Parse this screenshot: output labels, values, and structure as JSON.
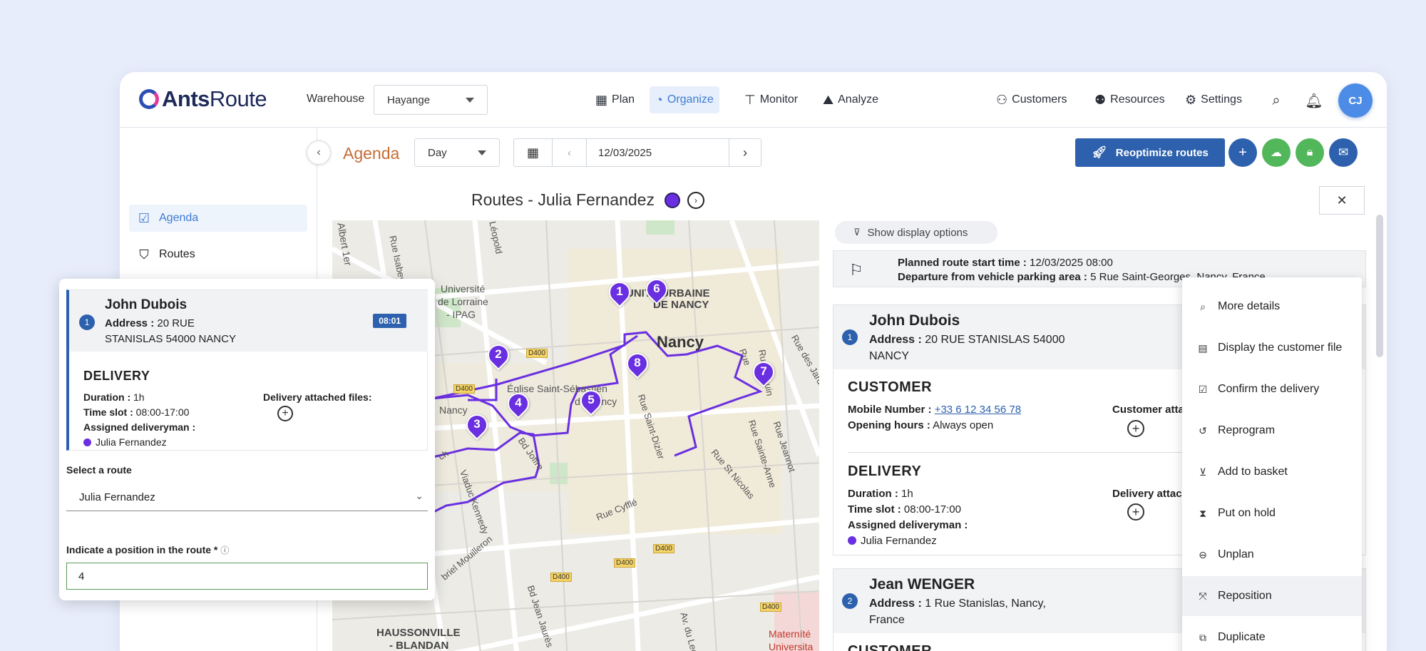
{
  "brand": {
    "name_bold": "Ants",
    "name_rest": "Route"
  },
  "header": {
    "warehouse_label": "Warehouse",
    "warehouse_value": "Hayange",
    "nav": {
      "plan": "Plan",
      "organize": "Organize",
      "monitor": "Monitor",
      "analyze": "Analyze"
    },
    "right": {
      "customers": "Customers",
      "resources": "Resources",
      "settings": "Settings"
    },
    "avatar": "CJ"
  },
  "sidebar": {
    "items": [
      {
        "label": "Agenda",
        "active": true
      },
      {
        "label": "Routes",
        "active": false
      }
    ]
  },
  "toolbar": {
    "title": "Agenda",
    "view": "Day",
    "date": "12/03/2025",
    "reoptimize": "Reoptimize routes"
  },
  "routes": {
    "title": "Routes - Julia Fernandez",
    "route_color": "#6a2fe0"
  },
  "map": {
    "labels": {
      "nancy": "Nancy",
      "urbaine": "UNITÉ URBAINE",
      "de_nancy": "DE NANCY",
      "univ1": "Université",
      "univ2": "de Lorraine",
      "univ3": "- IPAG",
      "eglise1": "Église Saint-Sébastien",
      "eglise2": "de Nancy",
      "nancy_small": "Nancy",
      "haussonville1": "HAUSSONVILLE",
      "haussonville2": "- BLANDAN",
      "maternite1": "Materníté",
      "maternite2": "Universita",
      "rue_st_dizier": "Rue Saint-Dizier",
      "rue_st_nicolas": "Rue St Nicolas",
      "rue_ste_anne": "Rue Sainte-Anne",
      "rue_jeannot": "Rue Jeannot",
      "rue_drouin": "Rue Drouin",
      "rue_jardins": "Rue des Jardins",
      "rue_cyffle": "Rue Cyfflé",
      "bd_joffre": "Bd Joffre",
      "viaduc": "Viaduc Kennedy",
      "mouilleron": "briel Mouilleron",
      "bd_jean": "Bd Jean Jaurès",
      "leclerc": "Av. du Leclerc",
      "leopold": "Léopold",
      "albert": "Albert 1er",
      "isabey": "Rue Isabey",
      "rue_st_georges": "Rue Saint-Georges",
      "rue_amp": "Rue",
      "bd_ch": "ch",
      "d400": "D400"
    },
    "pins": [
      "1",
      "2",
      "3",
      "4",
      "5",
      "6",
      "7",
      "8"
    ]
  },
  "details": {
    "display_options": "Show display options",
    "start_time_label": "Planned route start time :",
    "start_time_value": "12/03/2025 08:00",
    "departure_label": "Departure from vehicle parking area :",
    "departure_value": "5 Rue Saint-Georges, Nancy, France",
    "stops": [
      {
        "index": "1",
        "name": "John Dubois",
        "address_label": "Address :",
        "address_line1": "20 RUE STANISLAS 54000",
        "address_line2": "NANCY",
        "customer_title": "CUSTOMER",
        "mobile_label": "Mobile Number :",
        "mobile_value": "+33 6 12 34 56 78",
        "hours_label": "Opening hours :",
        "hours_value": "Always open",
        "customer_attach": "Customer atta",
        "delivery_title": "DELIVERY",
        "duration_label": "Duration :",
        "duration_value": "1h",
        "slot_label": "Time slot :",
        "slot_value": "08:00-17:00",
        "assigned_label": "Assigned deliveryman :",
        "assigned_value": "Julia Fernandez",
        "delivery_attach": "Delivery attac"
      },
      {
        "index": "2",
        "name": "Jean WENGER",
        "address_label": "Address :",
        "address_line1": "1 Rue Stanislas, Nancy,",
        "address_line2": "France",
        "customer_title": "CUSTOMER"
      }
    ]
  },
  "context_menu": {
    "items": [
      {
        "label": "More details",
        "icon": "zoom-icon"
      },
      {
        "label": "Display the customer file",
        "icon": "id-card-icon"
      },
      {
        "label": "Confirm the delivery",
        "icon": "calendar-check-icon"
      },
      {
        "label": "Reprogram",
        "icon": "history-icon"
      },
      {
        "label": "Add to basket",
        "icon": "cart-icon"
      },
      {
        "label": "Put on hold",
        "icon": "hourglass-icon"
      },
      {
        "label": "Unplan",
        "icon": "minus-circle-icon"
      },
      {
        "label": "Reposition",
        "icon": "move-icon"
      },
      {
        "label": "Duplicate",
        "icon": "copy-icon"
      }
    ]
  },
  "popup": {
    "index": "1",
    "name": "John Dubois",
    "address_label": "Address :",
    "address_line1": "20 RUE",
    "address_line2": "STANISLAS 54000 NANCY",
    "time": "08:01",
    "delivery_title": "DELIVERY",
    "duration_label": "Duration :",
    "duration_value": "1h",
    "slot_label": "Time slot :",
    "slot_value": "08:00-17:00",
    "assigned_label": "Assigned deliveryman :",
    "assigned_value": "Julia Fernandez",
    "files_label": "Delivery attached files:",
    "select_label": "Select a route",
    "select_value": "Julia  Fernandez",
    "position_label": "Indicate a position in the route *",
    "position_value": "4"
  }
}
